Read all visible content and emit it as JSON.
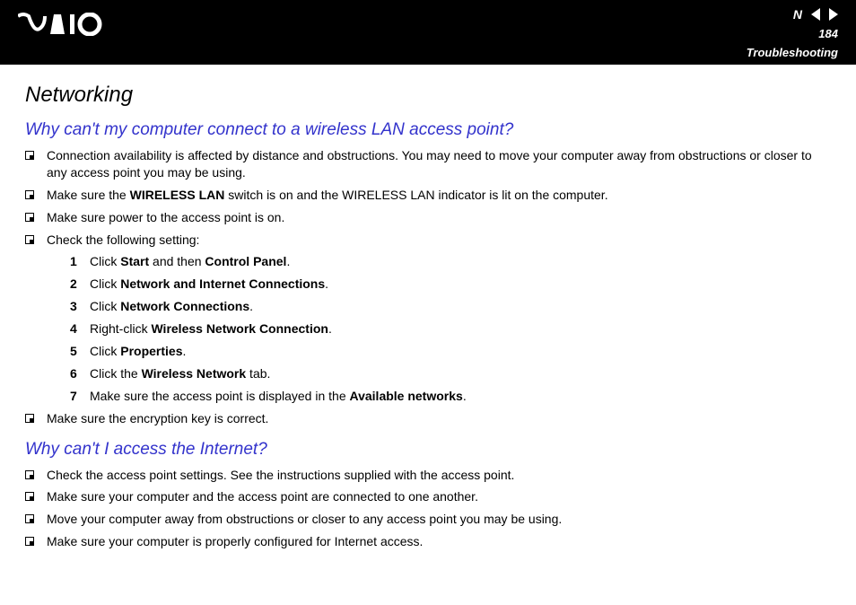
{
  "header": {
    "page_number": "184",
    "section": "Troubleshooting",
    "n_label": "N"
  },
  "title": "Networking",
  "q1": {
    "heading": "Why can't my computer connect to a wireless LAN access point?",
    "b1": "Connection availability is affected by distance and obstructions. You may need to move your computer away from obstructions or closer to any access point you may be using.",
    "b2_pre": "Make sure the ",
    "b2_bold": "WIRELESS LAN",
    "b2_post": " switch is on and the WIRELESS LAN indicator is lit on the computer.",
    "b3": "Make sure power to the access point is on.",
    "b4": "Check the following setting:",
    "steps": {
      "s1_pre": "Click ",
      "s1_b1": "Start",
      "s1_mid": " and then ",
      "s1_b2": "Control Panel",
      "s1_post": ".",
      "s2_pre": "Click ",
      "s2_b": "Network and Internet Connections",
      "s2_post": ".",
      "s3_pre": "Click ",
      "s3_b": "Network Connections",
      "s3_post": ".",
      "s4_pre": "Right-click ",
      "s4_b": "Wireless Network Connection",
      "s4_post": ".",
      "s5_pre": "Click ",
      "s5_b": "Properties",
      "s5_post": ".",
      "s6_pre": "Click the ",
      "s6_b": "Wireless Network",
      "s6_post": " tab.",
      "s7_pre": "Make sure the access point is displayed in the ",
      "s7_b": "Available networks",
      "s7_post": "."
    },
    "b5": "Make sure the encryption key is correct."
  },
  "q2": {
    "heading": "Why can't I access the Internet?",
    "b1": "Check the access point settings. See the instructions supplied with the access point.",
    "b2": "Make sure your computer and the access point are connected to one another.",
    "b3": "Move your computer away from obstructions or closer to any access point you may be using.",
    "b4": "Make sure your computer is properly configured for Internet access."
  },
  "nums": {
    "n1": "1",
    "n2": "2",
    "n3": "3",
    "n4": "4",
    "n5": "5",
    "n6": "6",
    "n7": "7"
  }
}
